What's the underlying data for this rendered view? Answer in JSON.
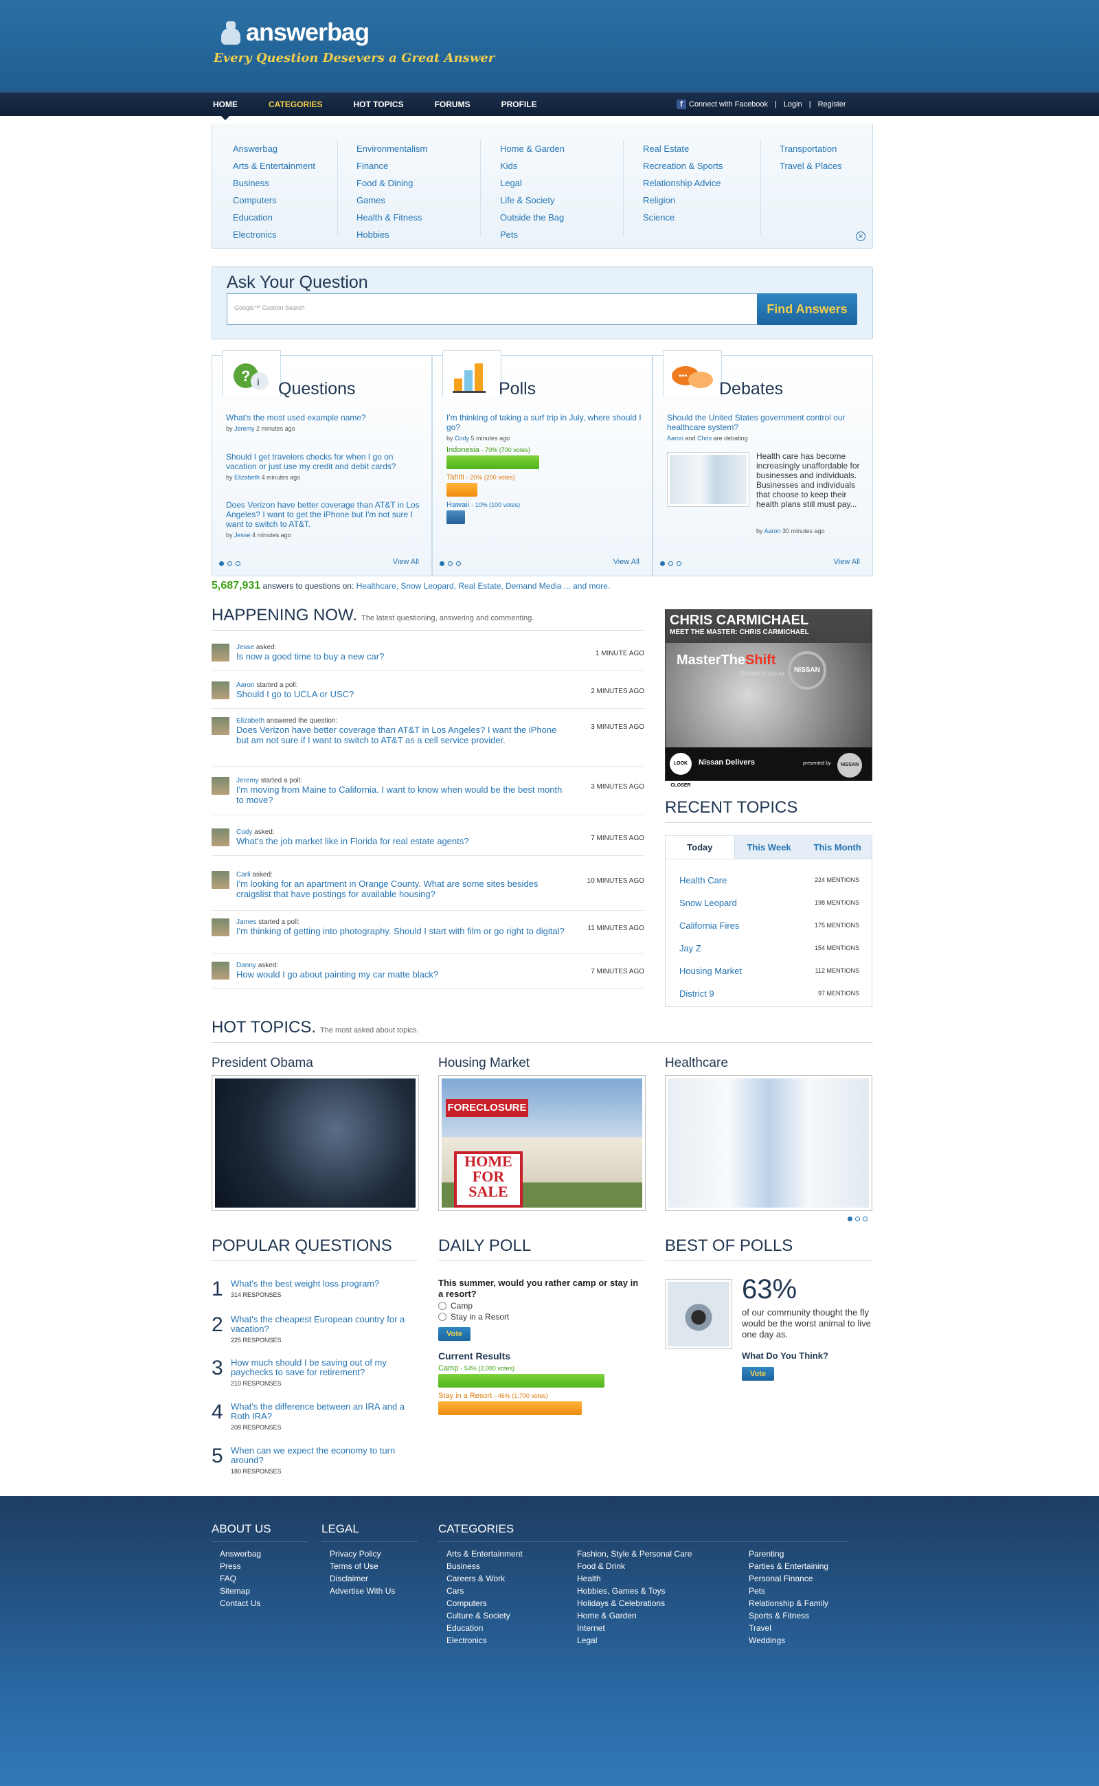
{
  "logo": {
    "text": "answerbag",
    "tagline": "Every Question Desevers a Great Answer"
  },
  "nav": {
    "items": [
      "HOME",
      "CATEGORIES",
      "HOT TOPICS",
      "FORUMS",
      "PROFILE"
    ],
    "connect": "Connect with Facebook",
    "login": "Login",
    "register": "Register"
  },
  "categories": [
    [
      "Answerbag",
      "Arts & Entertainment",
      "Business",
      "Computers",
      "Education",
      "Electronics"
    ],
    [
      "Environmentalism",
      "Finance",
      "Food & Dining",
      "Games",
      "Health & Fitness",
      "Hobbies"
    ],
    [
      "Home & Garden",
      "Kids",
      "Legal",
      "Life & Society",
      "Outside the Bag",
      "Pets"
    ],
    [
      "Real Estate",
      "Recreation & Sports",
      "Relationship Advice",
      "Religion",
      "Science"
    ],
    [
      "Transportation",
      "Travel & Places"
    ]
  ],
  "ask": {
    "title": "Ask Your Question",
    "placeholder": "Google™ Custom Search",
    "button": "Find Answers"
  },
  "questions": {
    "title": "Questions",
    "view_all": "View All",
    "items": [
      {
        "text": "What's the most used example name?",
        "user": "Jeremy",
        "time": "2 minutes ago"
      },
      {
        "text": "Should I get travelers checks for when I go on vacation or just use my credit and debit cards?",
        "user": "Elizabeth",
        "time": "4 minutes ago"
      },
      {
        "text": "Does Verizon have better coverage than AT&T in Los Angeles? I want to get the iPhone but I'm not sure I want to switch to AT&T.",
        "user": "Jesse",
        "time": "4 minutes ago"
      }
    ]
  },
  "polls": {
    "title": "Polls",
    "view_all": "View All",
    "question": "I'm thinking of taking a surf trip in July, where should I go?",
    "user": "Cody",
    "time": "5 minutes ago",
    "options": [
      {
        "name": "Indonesia",
        "detail": "- 70% (700 votes)",
        "pct": 70
      },
      {
        "name": "Tahiti",
        "detail": "- 20% (200 votes)",
        "pct": 20
      },
      {
        "name": "Hawaii",
        "detail": "- 10% (100 votes)",
        "pct": 10
      }
    ]
  },
  "debates": {
    "title": "Debates",
    "view_all": "View All",
    "question": "Should the United States government control our healthcare system?",
    "user1": "Aaron",
    "and": "and",
    "user2": "Chris",
    "debating": "are debating",
    "body": "Health care has become increasingly unaffordable for businesses and individuals. Businesses and individuals that choose to keep their health plans still must pay...",
    "user": "Aaron",
    "time": "30 minutes ago"
  },
  "count": {
    "number": "5,687,931",
    "text": "answers to questions on:",
    "topics": "Healthcare, Snow Leopard, Real Estate, Demand Media ... and more."
  },
  "happening": {
    "title": "HAPPENING NOW.",
    "subtitle": "The latest questioning, answering and commenting.",
    "items": [
      {
        "user": "Jesse",
        "action": "asked:",
        "text": "Is now a good time to buy a new car?",
        "time": "1 MINUTE AGO"
      },
      {
        "user": "Aaron",
        "action": "started a poll:",
        "text": "Should I go to UCLA or USC?",
        "time": "2 MINUTES AGO"
      },
      {
        "user": "Elizabeth",
        "action": "answered the question:",
        "text": "Does Verizon have better coverage than AT&T in Los Angeles? I want the iPhone but am not sure if I want to switch to AT&T as a cell service provider.",
        "time": "3 MINUTES AGO"
      },
      {
        "user": "Jeremy",
        "action": "started a poll:",
        "text": "I'm moving from Maine to California. I want to know when would be the best month to move?",
        "time": "3 MINUTES AGO"
      },
      {
        "user": "Cody",
        "action": "asked:",
        "text": "What's the job market like in Florida for real estate agents?",
        "time": "7 MINUTES AGO"
      },
      {
        "user": "Carli",
        "action": "asked:",
        "text": "I'm looking for an apartment in Orange County. What are some sites besides craigslist that have postings for available housing?",
        "time": "10 MINUTES AGO"
      },
      {
        "user": "James",
        "action": "started a poll:",
        "text": "I'm thinking of getting into photography. Should I start with film or go right to digital?",
        "time": "11 MINUTES AGO"
      },
      {
        "user": "Danny",
        "action": "asked:",
        "text": "How would I go about painting my car matte black?",
        "time": "7 MINUTES AGO"
      }
    ]
  },
  "ad": {
    "name": "CHRIS CARMICHAEL",
    "sub": "MEET THE MASTER: CHRIS CARMICHAEL",
    "brand1": "Master",
    "brand2": "The",
    "brand3": "Shift",
    "brought": "Brought to you by",
    "nissan": "NISSAN",
    "look": "LOOK CLOSER",
    "delivers": "Nissan Delivers",
    "presented": "presented by"
  },
  "recent": {
    "title": "RECENT TOPICS",
    "tabs": [
      "Today",
      "This Week",
      "This Month"
    ],
    "items": [
      {
        "name": "Health Care",
        "mentions": "224 MENTIONS"
      },
      {
        "name": "Snow Leopard",
        "mentions": "198 MENTIONS"
      },
      {
        "name": "California Fires",
        "mentions": "175 MENTIONS"
      },
      {
        "name": "Jay Z",
        "mentions": "154 MENTIONS"
      },
      {
        "name": "Housing Market",
        "mentions": "112 MENTIONS"
      },
      {
        "name": "District 9",
        "mentions": "97 MENTIONS"
      }
    ]
  },
  "hot": {
    "title": "HOT TOPICS.",
    "subtitle": "The most asked about topics.",
    "items": [
      "President Obama",
      "Housing Market",
      "Healthcare"
    ],
    "sign1": "FORECLOSURE",
    "sign2": "HOME",
    "sign3": "FOR",
    "sign4": "SALE"
  },
  "popular": {
    "title": "POPULAR QUESTIONS",
    "items": [
      {
        "n": "1",
        "text": "What's the best weight loss program?",
        "resp": "314 RESPONSES"
      },
      {
        "n": "2",
        "text": "What's the cheapest European country for a vacation?",
        "resp": "225 RESPONSES"
      },
      {
        "n": "3",
        "text": "How much should I be saving out of my paychecks to save for retirement?",
        "resp": "210 RESPONSES"
      },
      {
        "n": "4",
        "text": "What's the difference between an IRA and a Roth IRA?",
        "resp": "208 RESPONSES"
      },
      {
        "n": "5",
        "text": "When can we expect the economy to turn around?",
        "resp": "180 RESPONSES"
      }
    ]
  },
  "daily": {
    "title": "DAILY POLL",
    "question": "This summer, would you rather camp or stay in a resort?",
    "options": [
      "Camp",
      "Stay in a Resort"
    ],
    "vote": "Vote",
    "results_title": "Current Results",
    "results": [
      {
        "name": "Camp",
        "detail": "- 54% (2,000 votes)",
        "pct": 54
      },
      {
        "name": "Stay in a Resort",
        "detail": "- 46% (1,700 votes)",
        "pct": 46
      }
    ]
  },
  "best": {
    "title": "BEST OF POLLS",
    "pct": "63%",
    "text": "of our community thought the fly would be the worst animal to live one day as.",
    "wd": "What Do You Think?",
    "vote": "Vote"
  },
  "footer": {
    "about": {
      "title": "ABOUT US",
      "links": [
        "Answerbag",
        "Press",
        "FAQ",
        "Sitemap",
        "Contact Us"
      ]
    },
    "legal": {
      "title": "LEGAL",
      "links": [
        "Privacy Policy",
        "Terms of Use",
        "Disclaimer",
        "Advertise With Us"
      ]
    },
    "cats": {
      "title": "CATEGORIES",
      "col1": [
        "Arts & Entertainment",
        "Business",
        "Careers & Work",
        "Cars",
        "Computers",
        "Culture & Society",
        "Education",
        "Electronics"
      ],
      "col2": [
        "Fashion, Style & Personal Care",
        "Food & Drink",
        "Health",
        "Hobbies, Games & Toys",
        "Holidays & Celebrations",
        "Home & Garden",
        "Internet",
        "Legal"
      ],
      "col3": [
        "Parenting",
        "Parties & Entertaining",
        "Personal Finance",
        "Pets",
        "Relationship & Family",
        "Sports & Fitness",
        "Travel",
        "Weddings"
      ]
    }
  }
}
